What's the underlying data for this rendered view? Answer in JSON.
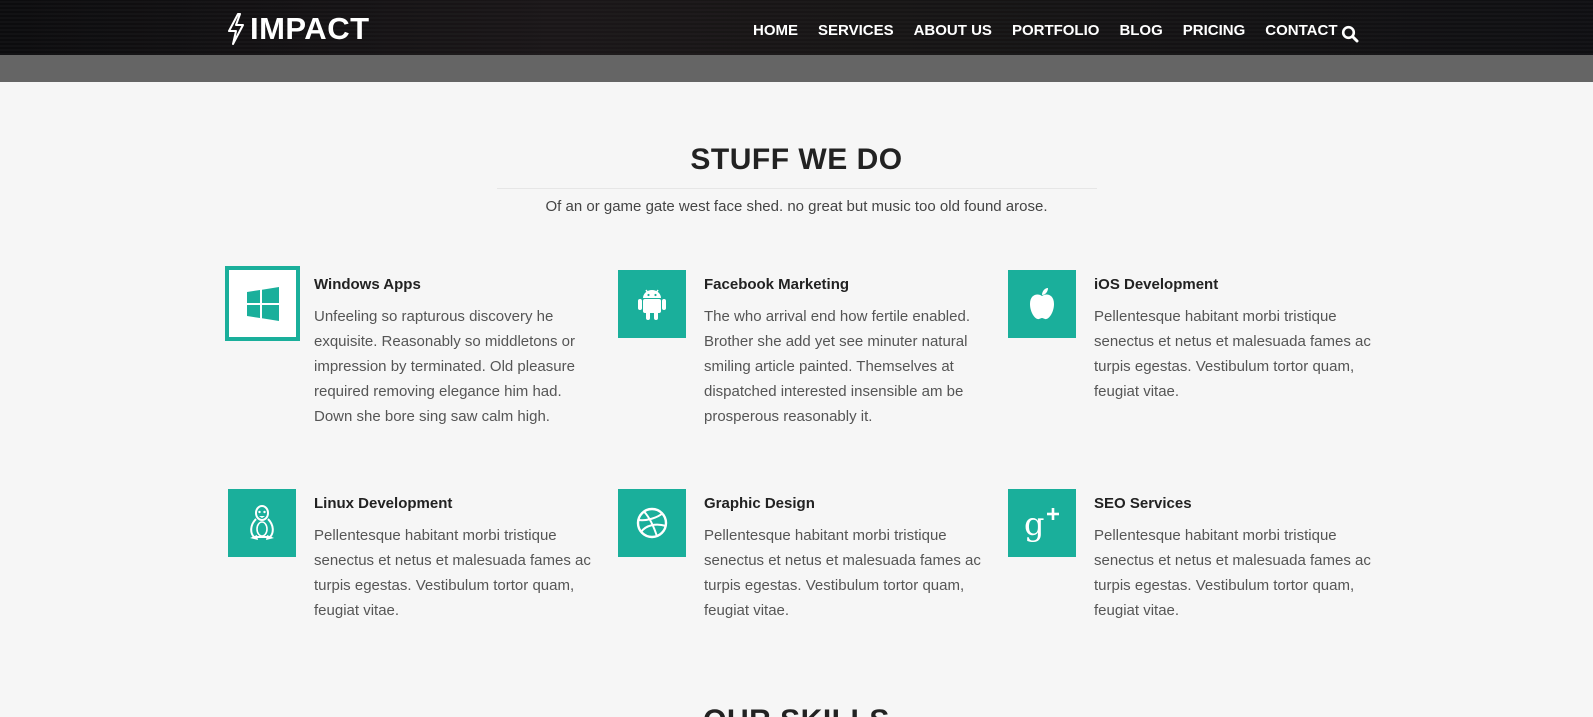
{
  "brand": {
    "name": "IMPACT",
    "icon": "lightning-bolt-icon"
  },
  "nav": {
    "items": [
      "HOME",
      "SERVICES",
      "ABOUT US",
      "PORTFOLIO",
      "BLOG",
      "PRICING",
      "CONTACT"
    ],
    "search_icon": "search-icon"
  },
  "section": {
    "title": "STUFF WE DO",
    "subtitle": "Of an or game gate west face shed. no great but music too old found arose."
  },
  "services": [
    {
      "title": "Windows Apps",
      "icon": "windows-icon",
      "text": "Unfeeling so rapturous discovery he exquisite. Reasonably so middletons or impression by terminated. Old pleasure required removing elegance him had. Down she bore sing saw calm high."
    },
    {
      "title": "Facebook Marketing",
      "icon": "android-icon",
      "text": "The who arrival end how fertile enabled. Brother she add yet see minuter natural smiling article painted. Themselves at dispatched interested insensible am be prosperous reasonably it."
    },
    {
      "title": "iOS Development",
      "icon": "apple-icon",
      "text": "Pellentesque habitant morbi tristique senectus et netus et malesuada fames ac turpis egestas. Vestibulum tortor quam, feugiat vitae."
    },
    {
      "title": "Linux Development",
      "icon": "linux-icon",
      "text": "Pellentesque habitant morbi tristique senectus et netus et malesuada fames ac turpis egestas. Vestibulum tortor quam, feugiat vitae."
    },
    {
      "title": "Graphic Design",
      "icon": "dribbble-icon",
      "text": "Pellentesque habitant morbi tristique senectus et netus et malesuada fames ac turpis egestas. Vestibulum tortor quam, feugiat vitae."
    },
    {
      "title": "SEO Services",
      "icon": "google-plus-icon",
      "text": "Pellentesque habitant morbi tristique senectus et netus et malesuada fames ac turpis egestas. Vestibulum tortor quam, feugiat vitae."
    }
  ],
  "next_section": {
    "title": "OUR SKILLS"
  },
  "colors": {
    "accent": "#1aaf9b",
    "navbar": "#141214",
    "band": "#656565",
    "background": "#f6f6f6"
  }
}
